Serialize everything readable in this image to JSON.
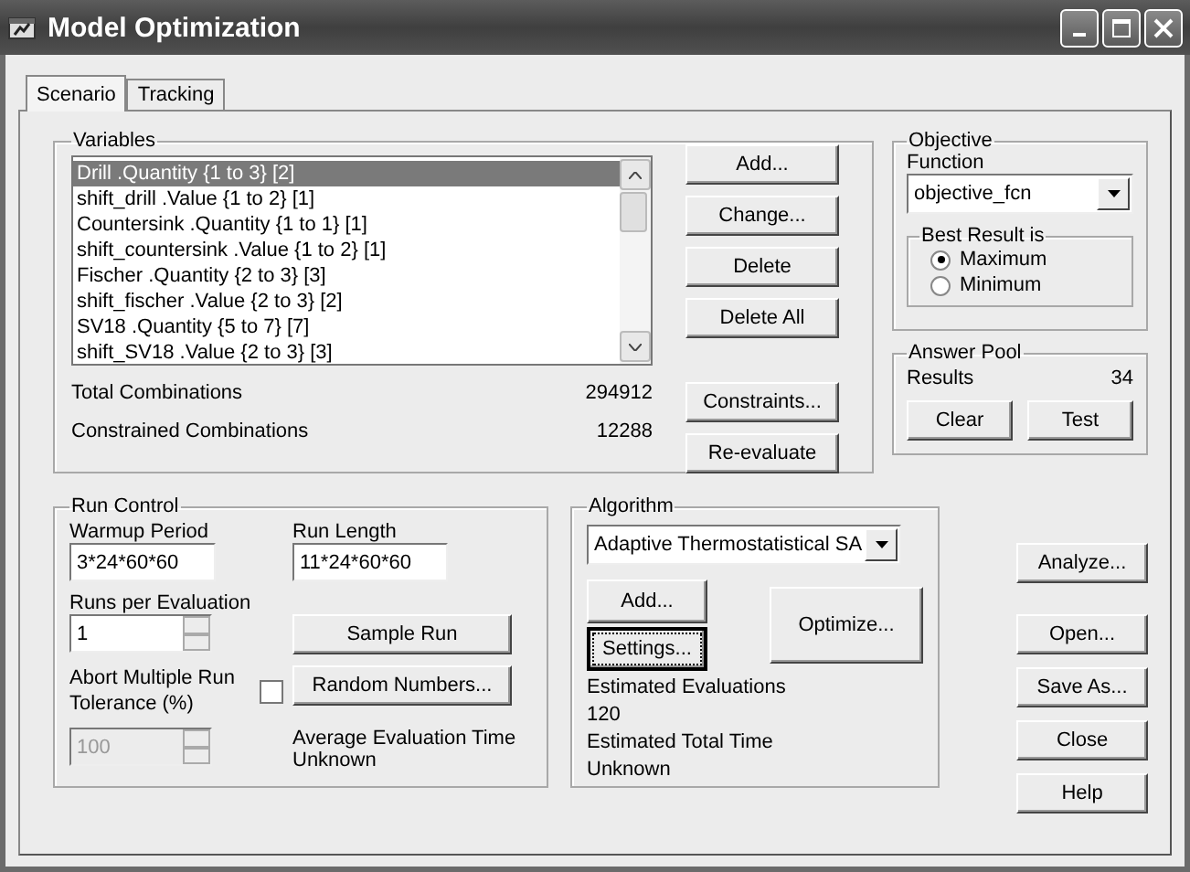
{
  "window": {
    "title": "Model Optimization"
  },
  "tabs": [
    {
      "label": "Scenario",
      "selected": true
    },
    {
      "label": "Tracking",
      "selected": false
    }
  ],
  "variables": {
    "title": "Variables",
    "items": [
      {
        "label": "Drill .Quantity {1 to 3} [2]",
        "selected": true
      },
      {
        "label": "shift_drill .Value {1 to 2} [1]",
        "selected": false
      },
      {
        "label": "Countersink .Quantity {1 to 1} [1]",
        "selected": false
      },
      {
        "label": "shift_countersink .Value {1 to 2} [1]",
        "selected": false
      },
      {
        "label": "Fischer .Quantity {2 to 3} [3]",
        "selected": false
      },
      {
        "label": "shift_fischer .Value {2 to 3} [2]",
        "selected": false
      },
      {
        "label": "SV18 .Quantity {5 to 7} [7]",
        "selected": false
      },
      {
        "label": "shift_SV18 .Value {2 to 3} [3]",
        "selected": false
      }
    ],
    "stats": [
      {
        "label": "Total Combinations",
        "value": "294912"
      },
      {
        "label": "Constrained Combinations",
        "value": "12288"
      }
    ],
    "buttons": [
      "Add...",
      "Change...",
      "Delete",
      "Delete All"
    ],
    "lower_buttons": [
      "Constraints...",
      "Re-evaluate"
    ]
  },
  "objective": {
    "title": "Objective",
    "function_label": "Function",
    "function_value": "objective_fcn",
    "best_result": {
      "title": "Best Result is",
      "options": [
        {
          "label": "Maximum",
          "selected": true
        },
        {
          "label": "Minimum",
          "selected": false
        }
      ]
    }
  },
  "answer_pool": {
    "title": "Answer Pool",
    "results_label": "Results",
    "results_value": "34",
    "buttons": [
      "Clear",
      "Test"
    ]
  },
  "run_control": {
    "title": "Run Control",
    "warmup_label": "Warmup Period",
    "warmup_value": "3*24*60*60",
    "run_length_label": "Run Length",
    "run_length_value": "11*24*60*60",
    "runs_label": "Runs per Evaluation",
    "runs_value": "1",
    "abort_label": "Abort Multiple Run Tolerance (%)",
    "abort_checked": false,
    "tolerance_value": "100",
    "tolerance_disabled": true,
    "sample_button": "Sample Run",
    "random_button": "Random Numbers...",
    "avg_label": "Average Evaluation Time",
    "avg_value": "Unknown"
  },
  "algorithm": {
    "title": "Algorithm",
    "value": "Adaptive Thermostatistical SA",
    "add_button": "Add...",
    "settings_button": "Settings...",
    "settings_focused": true,
    "optimize_button": "Optimize...",
    "est_eval_label": "Estimated Evaluations",
    "est_eval_value": "120",
    "est_time_label": "Estimated Total Time",
    "est_time_value": "Unknown"
  },
  "side_buttons": [
    "Analyze...",
    "Open...",
    "Save As...",
    "Close",
    "Help"
  ]
}
